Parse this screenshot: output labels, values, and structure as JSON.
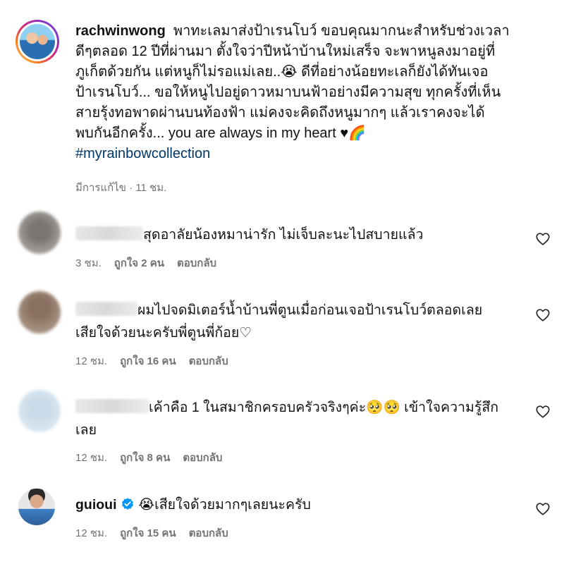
{
  "post": {
    "username": "rachwinwong",
    "lines": [
      "พาทะเลมาส่งป้าเรนโบว์ ขอบคุณมากนะสำหรับช่วงเวลา",
      "ดีๆตลอด 12 ปีที่ผ่านมา ตั้งใจว่าปีหน้าบ้านใหม่เสร็จ จะพาหนูลงมาอยู่ที่",
      "ภูเก็ตด้วยกัน แต่หนูก็ไม่รอแม่เลย..😭 ดีที่อย่างน้อยทะเลก็ยังได้ทันเจอ",
      "ป้าเรนโบว์... ขอให้หนูไปอยู่ดาวหมาบนฟ้าอย่างมีความสุข ทุกครั้งที่เห็น",
      "สายรุ้งทอพาดผ่านบนท้องฟ้า แม่คงจะคิดถึงหนูมากๆ แล้วเราคงจะได้",
      "พบกันอีกครั้ง... you are always in my heart ♥🌈"
    ],
    "hashtag": "#myrainbowcollection",
    "meta": "มีการแก้ไข · 11 ชม."
  },
  "comments": [
    {
      "text_lines": [
        "สุดอาลัยน้องหมาน่ารัก ไม่เจ็บละนะไปสบายแล้ว"
      ],
      "time": "3 ชม.",
      "likes": "ถูกใจ 2 คน",
      "reply": "ตอบกลับ"
    },
    {
      "text_lines": [
        "ผมไปจดมิเตอร์น้ำบ้านพี่ตูนเมื่อก่อนเจอป้าเรนโบว์ตลอดเลย",
        "เสียใจด้วยนะครับพี่ตูนพี่ก้อย♡"
      ],
      "time": "12 ชม.",
      "likes": "ถูกใจ 16 คน",
      "reply": "ตอบกลับ"
    },
    {
      "text_lines": [
        "เค้าคือ 1 ในสมาชิกครอบครัวจริงๆค่ะ🥺🥺 เข้าใจความรู้สึก",
        "เลย"
      ],
      "time": "12 ชม.",
      "likes": "ถูกใจ 8 คน",
      "reply": "ตอบกลับ"
    },
    {
      "username": "guioui",
      "text": "😭เสียใจด้วยมากๆเลยนะครับ",
      "time": "12 ชม.",
      "likes": "ถูกใจ 15 คน",
      "reply": "ตอบกลับ"
    }
  ],
  "icons": {
    "like": "heart-outline-icon",
    "verified": "verified-badge-icon"
  },
  "colors": {
    "text": "#111111",
    "meta": "#737373",
    "hashtag": "#00376b",
    "verified": "#0095f6",
    "story_ring": "#d62976"
  }
}
